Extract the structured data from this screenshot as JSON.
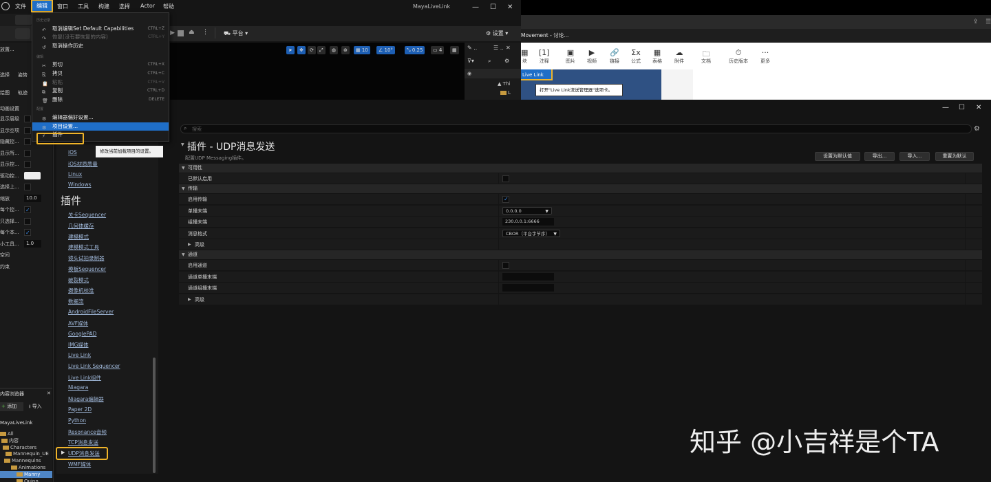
{
  "ue": {
    "menu": [
      "文件",
      "编辑",
      "窗口",
      "工具",
      "构建",
      "选择",
      "Actor",
      "帮助"
    ],
    "title": "MayaLiveLink",
    "toolbar": {
      "platform": "平台",
      "settings": "设置"
    },
    "viewport_chips": [
      "10",
      "10°",
      "0.25",
      "4"
    ],
    "outliner_items": [
      "Thi",
      "L"
    ],
    "left_strip": {
      "top_labels": [
        "放置...",
        "选择",
        "姿势",
        "绘图",
        "轨迹",
        "动画设置"
      ],
      "rows": [
        {
          "label": "显示层级",
          "kind": "check",
          "on": false
        },
        {
          "label": "显示空项",
          "kind": "check",
          "on": false
        },
        {
          "label": "隐藏控...",
          "kind": "check",
          "on": false
        },
        {
          "label": "显示所...",
          "kind": "check",
          "on": false
        },
        {
          "label": "显示控...",
          "kind": "check",
          "on": false
        },
        {
          "label": "驱动控...",
          "kind": "light",
          "on": false
        },
        {
          "label": "选择上...",
          "kind": "check",
          "on": false
        },
        {
          "label": "缩放",
          "kind": "value",
          "value": "10.0"
        },
        {
          "label": "每个控...",
          "kind": "check",
          "on": true
        },
        {
          "label": "只选择...",
          "kind": "check",
          "on": false
        },
        {
          "label": "每个本...",
          "kind": "check",
          "on": true
        },
        {
          "label": "小工具...",
          "kind": "value",
          "value": "1.0"
        },
        {
          "label": "空间",
          "kind": "none"
        },
        {
          "label": "约束",
          "kind": "none"
        }
      ]
    },
    "content_browser": {
      "title": "内容浏览器",
      "add": "添加",
      "import": "导入",
      "project": "MayaLiveLink",
      "tree": [
        "All",
        "内容",
        "Characters",
        "Mannequin_UE",
        "Mannequins",
        "Animations",
        "Manny",
        "Quinn"
      ]
    }
  },
  "edit_menu": {
    "sections": [
      "历史记录",
      "编辑",
      "配置"
    ],
    "items": [
      {
        "label": "取消编辑Set Default Capabilities",
        "shortcut": "CTRL+Z",
        "icon": "undo-icon",
        "dim": false
      },
      {
        "label": "恢复(没有要恢复的内容)",
        "shortcut": "CTRL+Y",
        "icon": "redo-icon",
        "dim": true
      },
      {
        "label": "取消操作历史",
        "shortcut": "",
        "icon": "history-icon",
        "dim": false
      },
      {
        "label": "剪切",
        "shortcut": "CTRL+X",
        "icon": "cut-icon",
        "dim": false
      },
      {
        "label": "拷贝",
        "shortcut": "CTRL+C",
        "icon": "copy-icon",
        "dim": false
      },
      {
        "label": "粘贴",
        "shortcut": "CTRL+V",
        "icon": "paste-icon",
        "dim": true
      },
      {
        "label": "复制",
        "shortcut": "CTRL+D",
        "icon": "duplicate-icon",
        "dim": false
      },
      {
        "label": "删除",
        "shortcut": "DELETE",
        "icon": "delete-icon",
        "dim": false
      },
      {
        "label": "编辑器偏好设置...",
        "shortcut": "",
        "icon": "prefs-icon",
        "dim": false
      },
      {
        "label": "项目设置...",
        "shortcut": "",
        "icon": "project-settings-icon",
        "dim": false,
        "highlight": true
      },
      {
        "label": "插件",
        "shortcut": "",
        "icon": "plugin-icon",
        "dim": false
      }
    ]
  },
  "tooltip": "修改当前加载项目的设置。",
  "settings": {
    "search_placeholder": "搜索",
    "nav_platform_links": [
      "iOS",
      "iOS材质质量",
      "Linux",
      "Windows"
    ],
    "nav_header": "插件",
    "nav_plugin_links": [
      "关卡Sequencer",
      "几何体缓存",
      "建模模式",
      "建模模式工具",
      "镜头试拍录制器",
      "模板Sequencer",
      "破裂模式",
      "摄像机校准",
      "数据流",
      "AndroidFileServer",
      "AVF媒体",
      "GooglePAD",
      "IMG媒体",
      "Live Link",
      "Live Link Sequencer",
      "Live Link组件",
      "Niagara",
      "Niagara编辑器",
      "Paper 2D",
      "Python",
      "Resonance音频",
      "TCP消息发送",
      "UDP消息发送",
      "WMF媒体"
    ],
    "title": "插件 - UDP消息发送",
    "subtitle": "配置UDP Messaging插件。",
    "buttons": [
      "设置为默认值",
      "导出...",
      "导入...",
      "重置为默认"
    ],
    "sections": [
      {
        "label": "可用性",
        "props": [
          {
            "label": "已默认启用",
            "kind": "check",
            "on": false
          }
        ]
      },
      {
        "label": "传输",
        "props": [
          {
            "label": "启用传输",
            "kind": "check",
            "on": true
          },
          {
            "label": "单播末端",
            "kind": "dropdown",
            "value": "0.0.0.0"
          },
          {
            "label": "组播末端",
            "kind": "text",
            "value": "230.0.0.1:6666"
          },
          {
            "label": "消息格式",
            "kind": "dropdown",
            "value": "CBOR（平台字节序）"
          },
          {
            "label": "高级",
            "kind": "sub"
          }
        ]
      },
      {
        "label": "通道",
        "props": [
          {
            "label": "启用通道",
            "kind": "check",
            "on": false
          },
          {
            "label": "通道单播末端",
            "kind": "text",
            "value": ""
          },
          {
            "label": "通道组播末端",
            "kind": "text",
            "value": ""
          },
          {
            "label": "高级",
            "kind": "sub"
          }
        ]
      }
    ]
  },
  "browser": {
    "tab_title": "Movement - 讨论...",
    "tools": [
      "块",
      "注释",
      "图片",
      "视频",
      "链接",
      "公式",
      "表格",
      "附件",
      "文档",
      "历史版本",
      "更多"
    ],
    "live_link_tab": "Live Link",
    "callout": "打开\"Live Link流送管理器\"选项卡。"
  },
  "watermark": "知乎 @小吉祥是个TA",
  "colors": {
    "accent": "#1f6ec7",
    "highlight": "#f0b429",
    "bg": "#141414"
  }
}
